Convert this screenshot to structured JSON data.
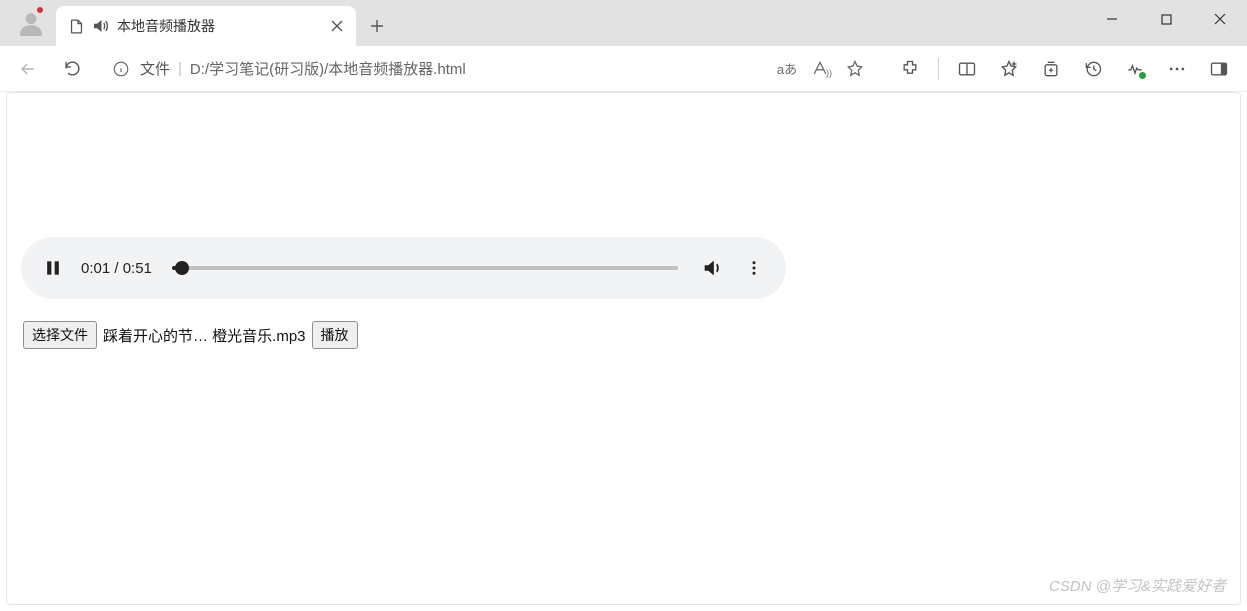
{
  "window": {
    "tab_title": "本地音频播放器"
  },
  "toolbar": {
    "address_label": "文件",
    "address_path": "D:/学习笔记(研习版)/本地音频播放器.html",
    "translate_label": "aあ"
  },
  "audio": {
    "current_time": "0:01",
    "duration": "0:51",
    "time_display": "0:01 / 0:51",
    "progress_percent": 2
  },
  "file_controls": {
    "choose_button_label": "选择文件",
    "selected_file_name": "踩着开心的节… 橙光音乐.mp3",
    "play_button_label": "播放"
  },
  "watermark": "CSDN @学习&实践爱好者"
}
